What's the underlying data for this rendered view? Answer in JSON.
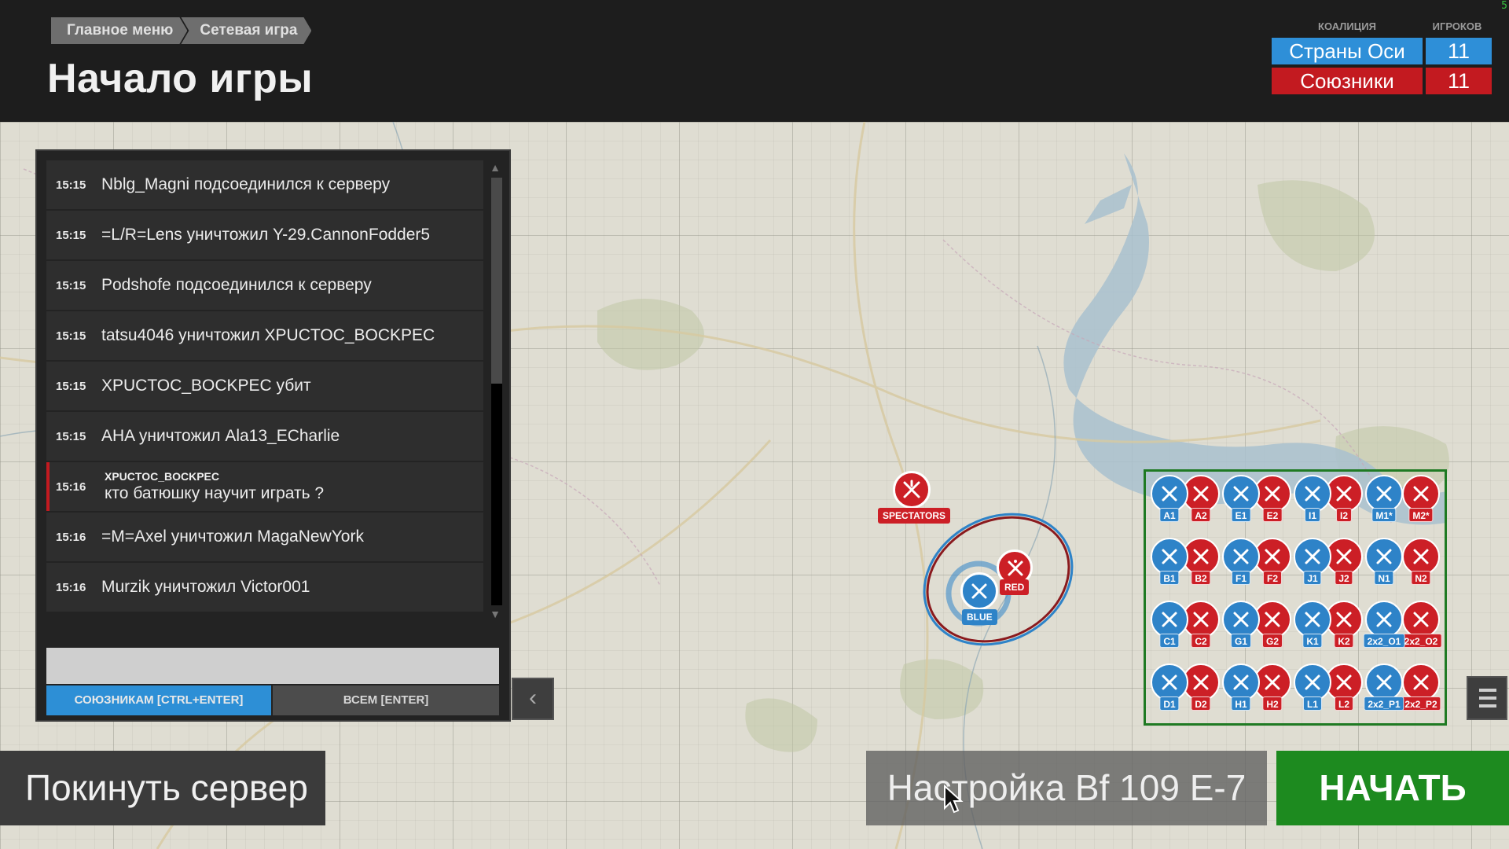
{
  "header": {
    "breadcrumbs": [
      "Главное меню",
      "Сетевая игра"
    ],
    "title": "Начало игры",
    "corner_tag": "5"
  },
  "coalitions": {
    "col_coalition": "КОАЛИЦИЯ",
    "col_players": "ИГРОКОВ",
    "axis": {
      "name": "Страны Оси",
      "count": "11",
      "color": "#2e8fd8"
    },
    "allies": {
      "name": "Союзники",
      "count": "11",
      "color": "#c31a20"
    }
  },
  "chat": {
    "messages": [
      {
        "time": "15:15",
        "text": "Nblg_Magni подсоединился к серверу"
      },
      {
        "time": "15:15",
        "text": "=L/R=Lens уничтожил Y-29.CannonFodder5"
      },
      {
        "time": "15:15",
        "text": "Podshofe подсоединился к серверу"
      },
      {
        "time": "15:15",
        "text": "tatsu4046 уничтожил XPUCTOC_BOCKPEC"
      },
      {
        "time": "15:15",
        "text": "XPUCTOC_BOCKPEC убит"
      },
      {
        "time": "15:15",
        "text": "AHA уничтожил Ala13_ECharlie"
      },
      {
        "time": "15:16",
        "sender": "XPUCTOC_BOCKPEC",
        "text": "кто батюшку научит играть ?"
      },
      {
        "time": "15:16",
        "text": "=M=Axel уничтожил MagaNewYork"
      },
      {
        "time": "15:16",
        "text": "Murzik уничтожил Victor001"
      }
    ],
    "input_value": "",
    "send_allies": "СОЮЗНИКАМ [CTRL+ENTER]",
    "send_all": "ВСЕМ [ENTER]"
  },
  "map": {
    "markers": {
      "spectators": "SPECTATORS",
      "red": "RED",
      "blue": "BLUE"
    },
    "squads": [
      {
        "label": "A1",
        "side": "blue"
      },
      {
        "label": "A2",
        "side": "red"
      },
      {
        "label": "E1",
        "side": "blue"
      },
      {
        "label": "E2",
        "side": "red"
      },
      {
        "label": "I1",
        "side": "blue"
      },
      {
        "label": "I2",
        "side": "red"
      },
      {
        "label": "M1*",
        "side": "blue"
      },
      {
        "label": "M2*",
        "side": "red"
      },
      {
        "label": "B1",
        "side": "blue"
      },
      {
        "label": "B2",
        "side": "red"
      },
      {
        "label": "F1",
        "side": "blue"
      },
      {
        "label": "F2",
        "side": "red"
      },
      {
        "label": "J1",
        "side": "blue"
      },
      {
        "label": "J2",
        "side": "red"
      },
      {
        "label": "N1",
        "side": "blue"
      },
      {
        "label": "N2",
        "side": "red"
      },
      {
        "label": "C1",
        "side": "blue"
      },
      {
        "label": "C2",
        "side": "red"
      },
      {
        "label": "G1",
        "side": "blue"
      },
      {
        "label": "G2",
        "side": "red"
      },
      {
        "label": "K1",
        "side": "blue"
      },
      {
        "label": "K2",
        "side": "red"
      },
      {
        "label": "2x2_O1",
        "side": "blue"
      },
      {
        "label": "2x2_O2",
        "side": "red"
      },
      {
        "label": "D1",
        "side": "blue"
      },
      {
        "label": "D2",
        "side": "red"
      },
      {
        "label": "H1",
        "side": "blue"
      },
      {
        "label": "H2",
        "side": "red"
      },
      {
        "label": "L1",
        "side": "blue"
      },
      {
        "label": "L2",
        "side": "red"
      },
      {
        "label": "2x2_P1",
        "side": "blue"
      },
      {
        "label": "2x2_P2",
        "side": "red"
      }
    ]
  },
  "bottom": {
    "leave": "Покинуть сервер",
    "setup": "Настройка Bf 109 E-7",
    "start": "НАЧАТЬ"
  },
  "colors": {
    "blue": "#2e83c8",
    "red": "#cc1f26",
    "green": "#1d8a1f"
  }
}
